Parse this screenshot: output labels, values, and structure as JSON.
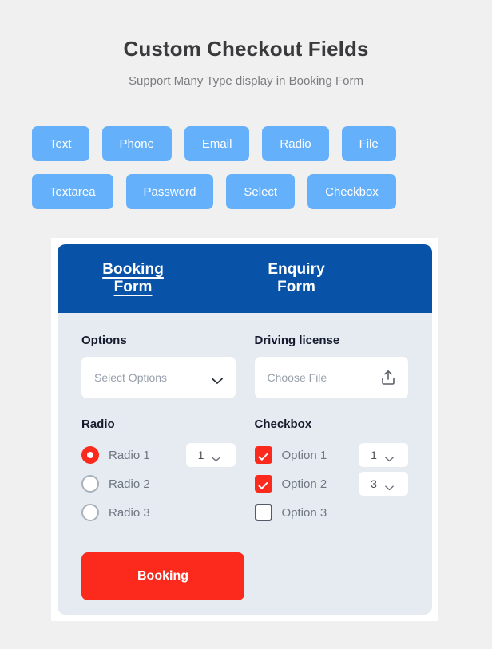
{
  "header": {
    "title": "Custom Checkout Fields",
    "subtitle": "Support Many Type display in Booking Form"
  },
  "type_buttons": {
    "row1": [
      {
        "label": "Text"
      },
      {
        "label": "Phone"
      },
      {
        "label": "Email"
      },
      {
        "label": "Radio"
      },
      {
        "label": "File"
      }
    ],
    "row2": [
      {
        "label": "Textarea"
      },
      {
        "label": "Password"
      },
      {
        "label": "Select"
      },
      {
        "label": "Checkbox"
      }
    ]
  },
  "form": {
    "tabs": [
      {
        "label": "Booking Form",
        "active": true
      },
      {
        "label": "Enquiry Form",
        "active": false
      }
    ],
    "options_field": {
      "label": "Options",
      "placeholder": "Select Options",
      "value": ""
    },
    "file_field": {
      "label": "Driving license",
      "placeholder": "Choose File",
      "value": ""
    },
    "radio_group": {
      "label": "Radio",
      "items": [
        {
          "label": "Radio 1",
          "checked": true,
          "qty": "1"
        },
        {
          "label": "Radio 2",
          "checked": false,
          "qty": null
        },
        {
          "label": "Radio 3",
          "checked": false,
          "qty": null
        }
      ]
    },
    "checkbox_group": {
      "label": "Checkbox",
      "items": [
        {
          "label": "Option 1",
          "checked": true,
          "qty": "1"
        },
        {
          "label": "Option 2",
          "checked": true,
          "qty": "3"
        },
        {
          "label": "Option 3",
          "checked": false,
          "qty": null
        }
      ]
    },
    "submit_label": "Booking"
  },
  "colors": {
    "page_bg": "#f0f0f0",
    "type_button": "#64b0fb",
    "header_blue": "#0853a8",
    "form_bg": "#e5ebf0",
    "accent_red": "#fc2a1c",
    "frame_white": "#ffffff"
  }
}
